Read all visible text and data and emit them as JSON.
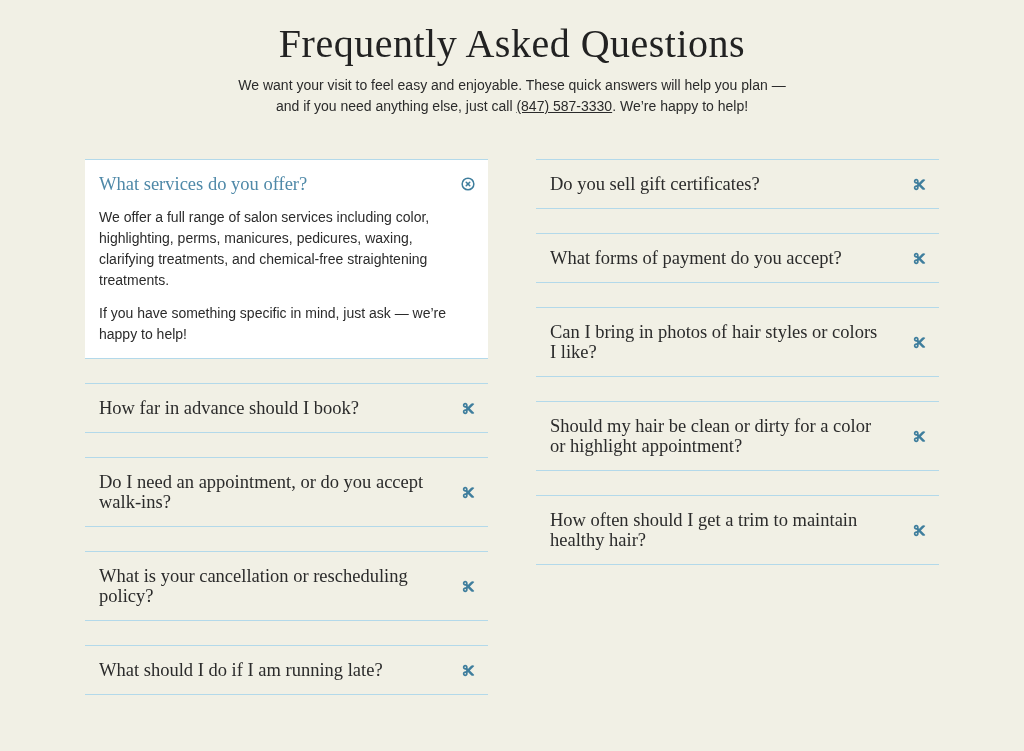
{
  "header": {
    "title": "Frequently Asked Questions",
    "intro": {
      "text_before": "We want your visit to feel easy and enjoyable. These quick answers will help you plan — and if you need anything else, just call ",
      "phone_link": "(847) 587-3330",
      "text_after": ". We’re happy to help!"
    }
  },
  "columns": [
    {
      "items": [
        {
          "question": "What services do you offer?",
          "expanded": true,
          "answer": [
            "We offer a full range of salon services including color, highlighting, perms, manicures, pedicures, waxing, clarifying treatments, and chemical-free straightening treatments.",
            "If you have something specific in mind, just ask — we’re happy to help!"
          ]
        },
        {
          "question": "How far in advance should I book?",
          "expanded": false
        },
        {
          "question": "Do I need an appointment, or do you accept walk-ins?",
          "expanded": false
        },
        {
          "question": "What is your cancellation or rescheduling policy?",
          "expanded": false
        },
        {
          "question": "What should I do if I am running late?",
          "expanded": false
        }
      ]
    },
    {
      "items": [
        {
          "question": "Do you sell gift certificates?",
          "expanded": false
        },
        {
          "question": "What forms of payment do you accept?",
          "expanded": false
        },
        {
          "question": "Can I bring in photos of hair styles or colors I like?",
          "expanded": false
        },
        {
          "question": "Should my hair be clean or dirty for a color or highlight appointment?",
          "expanded": false
        },
        {
          "question": "How often should I get a trim to maintain healthy hair?",
          "expanded": false
        }
      ]
    }
  ]
}
